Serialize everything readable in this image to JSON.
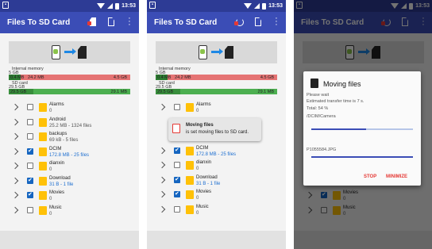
{
  "app": {
    "title": "Files To SD Card",
    "time": "13:53"
  },
  "storage": {
    "internal": {
      "label": "Internal memory",
      "total": "5 GB",
      "used": "0.4 MB",
      "used_size": "24.2 MB",
      "free": "4.5 GB",
      "used_fraction": 0.03
    },
    "sd": {
      "label": "SD card",
      "total": "29.5 GB",
      "used": "29.5 GB",
      "free": "29.1 MB",
      "used_fraction": 0.97
    }
  },
  "screen1": {
    "rows": [
      {
        "name": "Alarms",
        "sub": "0",
        "checked": false,
        "sub_highlight": false
      },
      {
        "name": "Android",
        "sub": "25.2 MB - 1324 files",
        "checked": false,
        "sub_highlight": false
      },
      {
        "name": "backups",
        "sub": "69 kB - 5 files",
        "checked": false,
        "sub_highlight": false
      },
      {
        "name": "DCIM",
        "sub": "172.8 MB - 25 files",
        "checked": true,
        "sub_highlight": true
      },
      {
        "name": "dianxin",
        "sub": "0",
        "checked": false,
        "sub_highlight": false
      },
      {
        "name": "Download",
        "sub": "31 B - 1 file",
        "checked": true,
        "sub_highlight": true
      },
      {
        "name": "Movies",
        "sub": "0",
        "checked": true,
        "sub_highlight": false
      },
      {
        "name": "Music",
        "sub": "0",
        "checked": false,
        "sub_highlight": false
      }
    ]
  },
  "screen2": {
    "rows": [
      {
        "name": "Alarms",
        "sub": "0",
        "checked": false,
        "sub_highlight": false
      },
      {
        "name": "DCIM",
        "sub": "172.8 MB - 25 files",
        "checked": true,
        "sub_highlight": true
      },
      {
        "name": "dianxin",
        "sub": "0",
        "checked": false,
        "sub_highlight": false
      },
      {
        "name": "Download",
        "sub": "31 B - 1 file",
        "checked": true,
        "sub_highlight": true
      },
      {
        "name": "Movies",
        "sub": "0",
        "checked": true,
        "sub_highlight": false
      },
      {
        "name": "Music",
        "sub": "0",
        "checked": false,
        "sub_highlight": false
      }
    ],
    "toast": {
      "title": "Moving files",
      "message": "is set moving files to SD card."
    }
  },
  "screen3": {
    "rows": [
      {
        "name": "Movies",
        "sub": "0",
        "checked": true
      },
      {
        "name": "Music",
        "sub": "0",
        "checked": false
      }
    ],
    "dialog": {
      "title": "Moving files",
      "wait": "Please wait",
      "estimate": "Estimated transfer time is 7 s.",
      "total": "Total: 54 %",
      "total_progress": 0.54,
      "folder": "/DCIM/Camera",
      "file": "P1055584.JPG",
      "file_progress": 1.0,
      "stop_label": "STOP",
      "minimize_label": "MINIMIZE"
    }
  },
  "colors": {
    "statusbar": "#2d3b95",
    "appbar": "#3b4db6",
    "free_bar_internal": "#e57373",
    "free_bar_sd": "#4caf50",
    "accent_red": "#e53935",
    "folder": "#ffc107"
  }
}
